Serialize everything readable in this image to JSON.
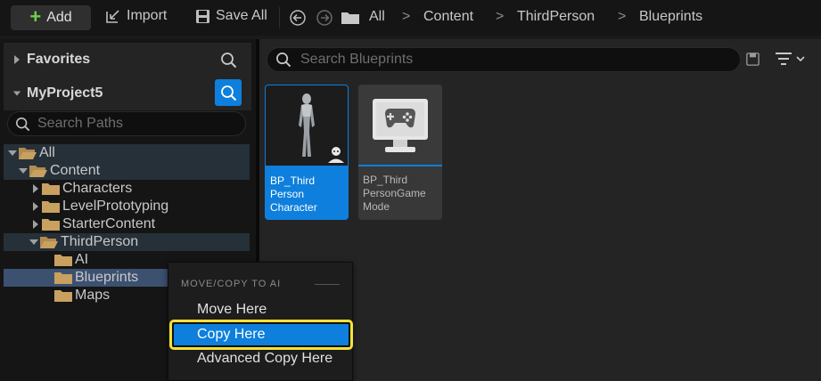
{
  "toolbar": {
    "add_label": "Add",
    "import_label": "Import",
    "save_all_label": "Save All",
    "breadcrumbs": [
      "All",
      "Content",
      "ThirdPerson",
      "Blueprints"
    ],
    "icons": [
      "back-arrow-icon",
      "forward-arrow-icon",
      "folder-icon",
      "import-icon",
      "save-icon"
    ]
  },
  "sidebar": {
    "favorites_label": "Favorites",
    "project_label": "MyProject5",
    "search_placeholder": "Search Paths",
    "tree": [
      {
        "label": "All"
      },
      {
        "label": "Content"
      },
      {
        "label": "Characters"
      },
      {
        "label": "LevelPrototyping"
      },
      {
        "label": "StarterContent"
      },
      {
        "label": "ThirdPerson"
      },
      {
        "label": "AI"
      },
      {
        "label": "Blueprints"
      },
      {
        "label": "Maps"
      }
    ]
  },
  "content": {
    "search_placeholder": "Search Blueprints",
    "assets": [
      {
        "label": "BP_Third Person Character",
        "lines": [
          "BP_Third",
          "Person",
          "Character"
        ],
        "selected": true
      },
      {
        "label": "BP_Third PersonGame Mode",
        "lines": [
          "BP_Third",
          "PersonGame",
          "Mode"
        ],
        "selected": false
      }
    ]
  },
  "context_menu": {
    "header": "MOVE/COPY TO AI",
    "items": [
      "Move Here",
      "Copy Here",
      "Advanced Copy Here"
    ],
    "highlighted": "Copy Here"
  },
  "colors": {
    "accent_blue": "#0e7fdc",
    "highlight_yellow": "#f4e13a",
    "add_green": "#6ad14c",
    "folder": "#c8a060"
  }
}
